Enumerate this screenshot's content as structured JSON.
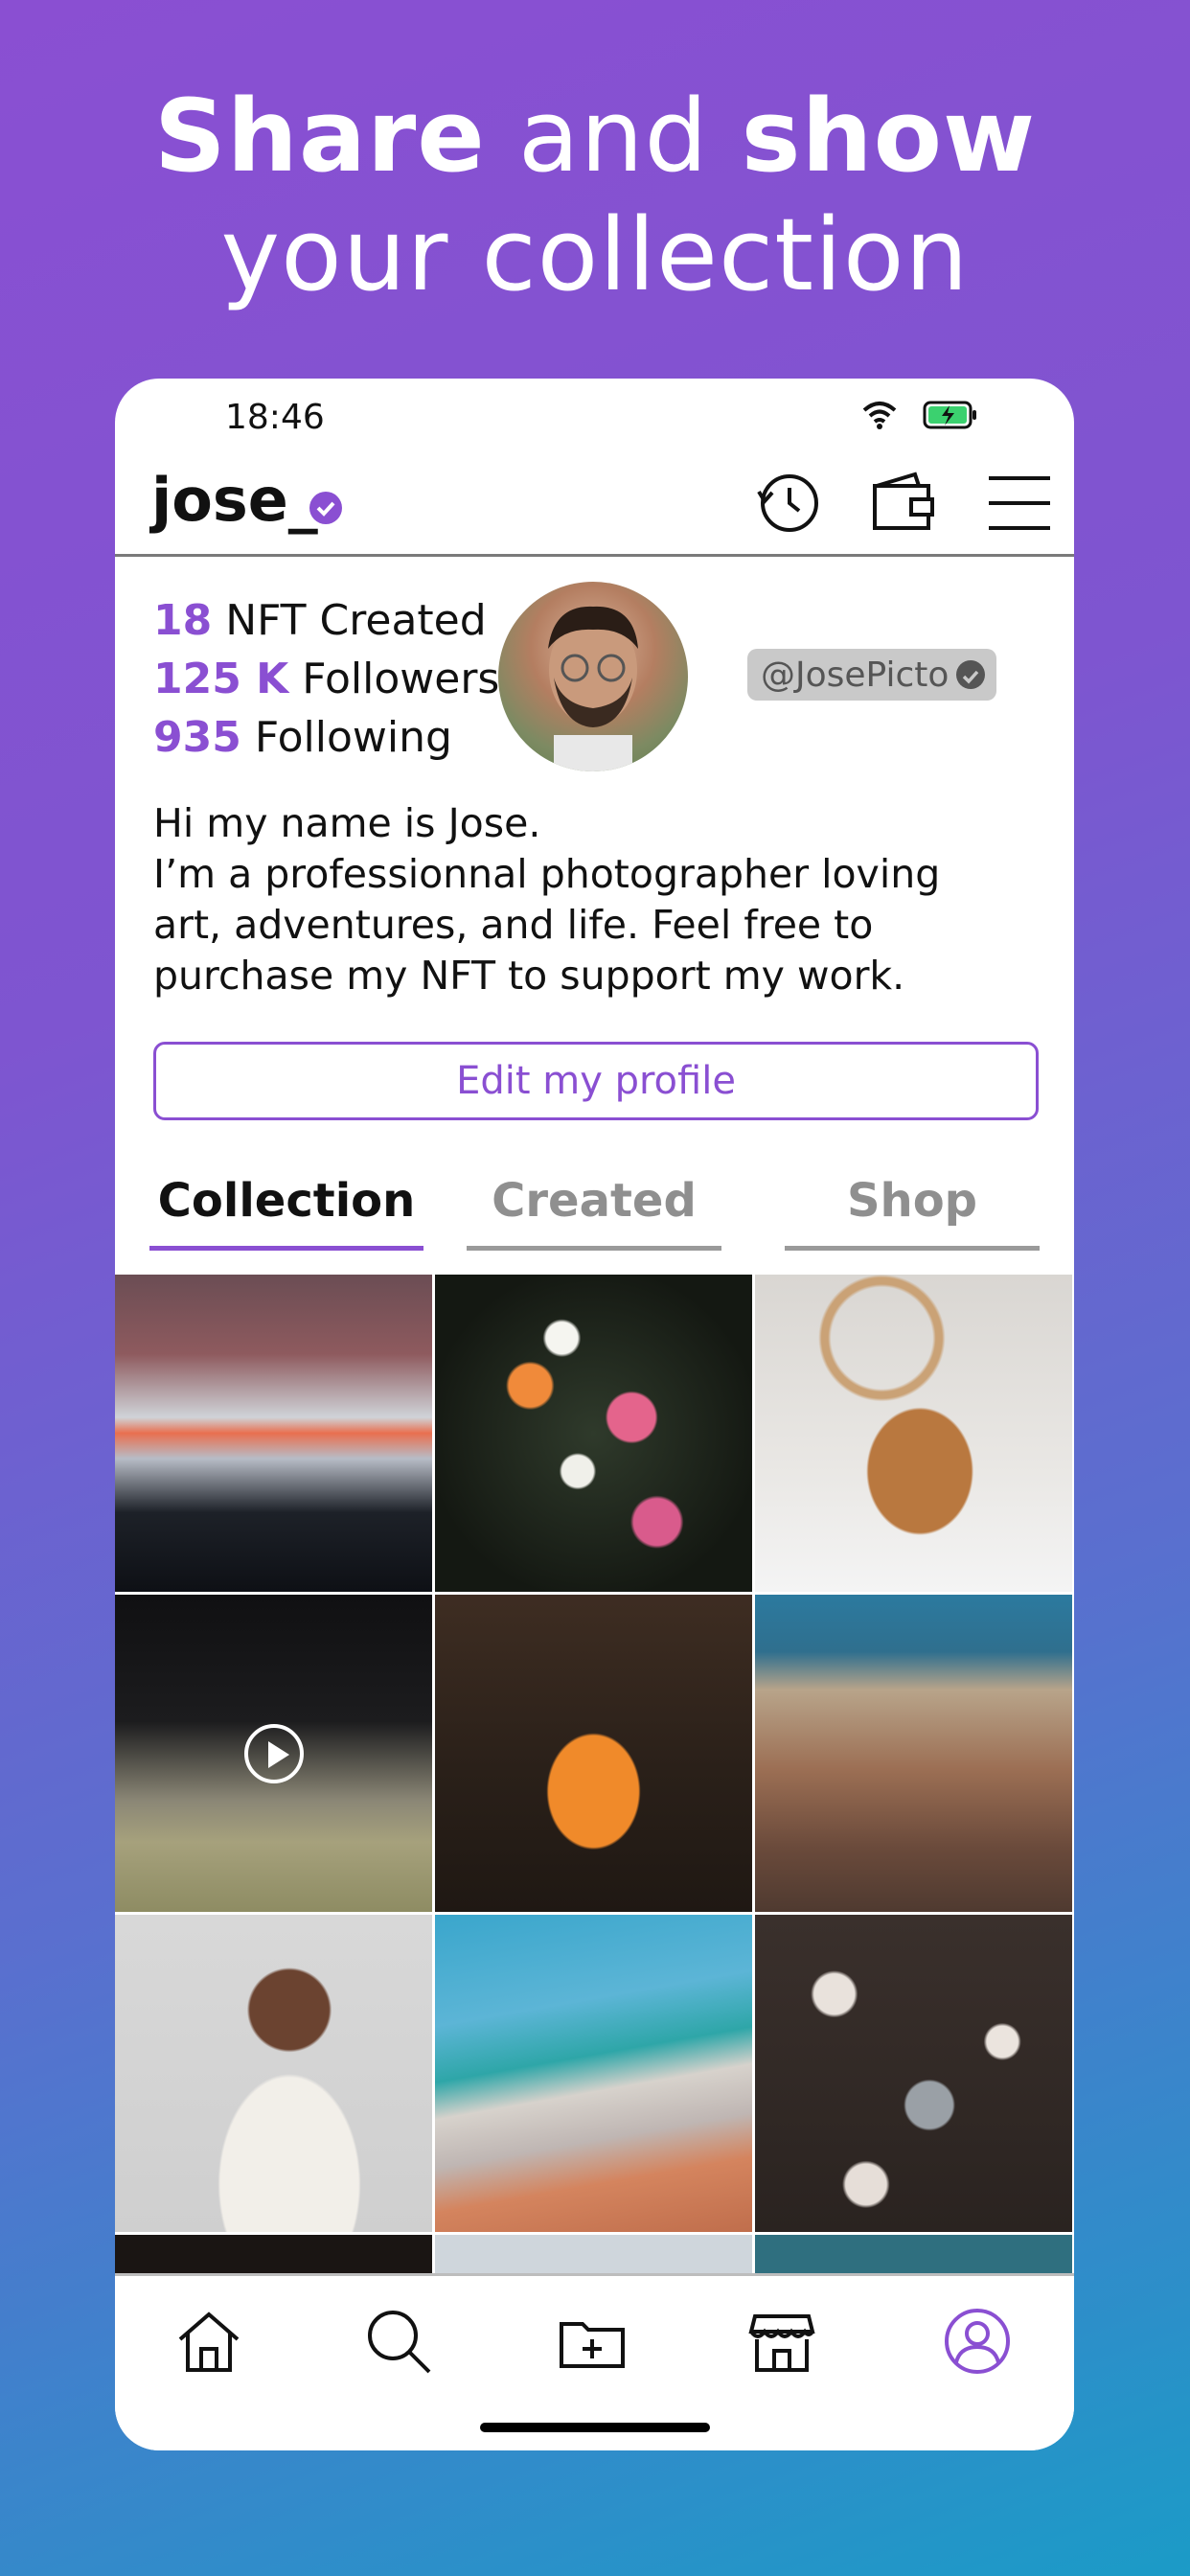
{
  "headline": {
    "line1_bold_a": "Share",
    "line1_light": " and ",
    "line1_bold_b": "show",
    "line2": "your collection"
  },
  "status_bar": {
    "time": "18:46",
    "icons": [
      "wifi-icon",
      "battery-charging-icon"
    ]
  },
  "profile": {
    "username": "jose_",
    "verified_icon": "verified-badge-icon",
    "top_icons": [
      "history-icon",
      "wallet-icon",
      "menu-icon"
    ],
    "stats": [
      {
        "value": "18",
        "label": " NFT Created"
      },
      {
        "value": "125 K",
        "label": " Followers"
      },
      {
        "value": "935",
        "label": " Following"
      }
    ],
    "handle": "@JosePicto",
    "bio": [
      "Hi my name is Jose.",
      "I’m a professionnal photographer loving",
      "art, adventures, and life. Feel free to",
      "purchase my NFT to support my work."
    ],
    "edit_button": "Edit my profile"
  },
  "tabs": [
    {
      "label": "Collection",
      "active": true
    },
    {
      "label": "Created",
      "active": false
    },
    {
      "label": "Shop",
      "active": false
    }
  ],
  "grid": {
    "items": [
      "mountain-sunset",
      "flower-bouquet",
      "poodle-dog",
      "baseball-game-video",
      "orange-sports-car",
      "city-aerial",
      "smiling-woman",
      "train",
      "camera-in-hand"
    ],
    "video_icon": "play-icon"
  },
  "nav": {
    "items": [
      "home-icon",
      "search-icon",
      "add-folder-icon",
      "shop-icon",
      "profile-icon"
    ],
    "active": "profile-icon"
  },
  "colors": {
    "accent": "#8a4fd2",
    "inactive_tab": "#8f8f8f"
  }
}
